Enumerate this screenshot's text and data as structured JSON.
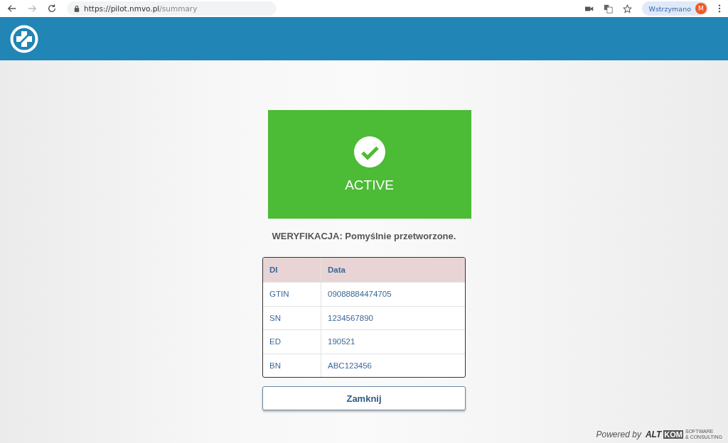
{
  "browser": {
    "url_host": "https://pilot.nmvo.pl",
    "url_path": "/summary",
    "profile_label": "Wstrzymano",
    "avatar_letter": "M"
  },
  "status": {
    "kind": "active",
    "label": "ACTIVE"
  },
  "message": "WERYFIKACJA: Pomyślnie przetworzone.",
  "table": {
    "columns": [
      "DI",
      "Data"
    ],
    "rows": [
      [
        "GTIN",
        "09088884474705"
      ],
      [
        "SN",
        "1234567890"
      ],
      [
        "ED",
        "190521"
      ],
      [
        "BN",
        "ABC123456"
      ]
    ]
  },
  "close_button": "Zamknij",
  "footer": {
    "powered_by": "Powered by",
    "logo_left": "ALT",
    "logo_right": "KOM",
    "logo_sub_1": "SOFTWARE",
    "logo_sub_2": "& CONSULTING"
  }
}
